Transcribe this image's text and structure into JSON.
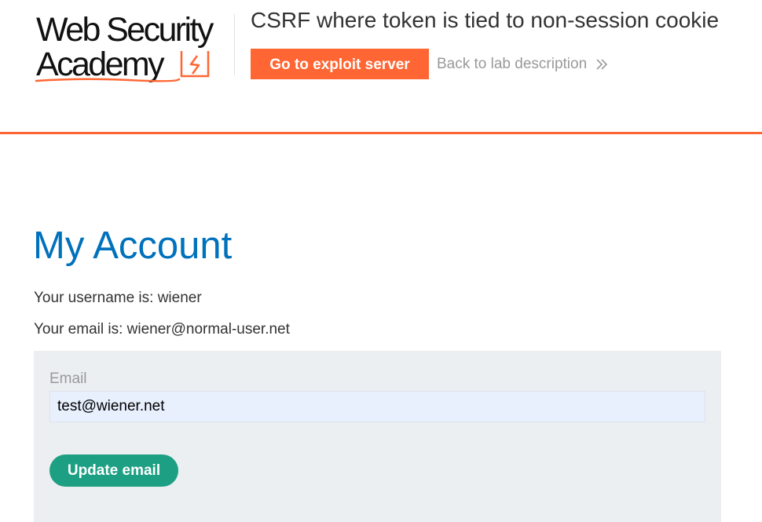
{
  "brand": {
    "logo_line1": "Web Security",
    "logo_line2": "Academy",
    "accent_color": "#ff6633"
  },
  "lab": {
    "title": "CSRF where token is tied to non-session cookie",
    "exploit_button": "Go to exploit server",
    "back_link": "Back to lab description",
    "back_icon": "double-chevron-right-icon"
  },
  "account": {
    "heading": "My Account",
    "username_line": "Your username is: wiener",
    "email_line": "Your email is: wiener@normal-user.net"
  },
  "form": {
    "email_label": "Email",
    "email_value": "test@wiener.net",
    "submit_label": "Update email",
    "submit_color": "#1c9f82"
  }
}
